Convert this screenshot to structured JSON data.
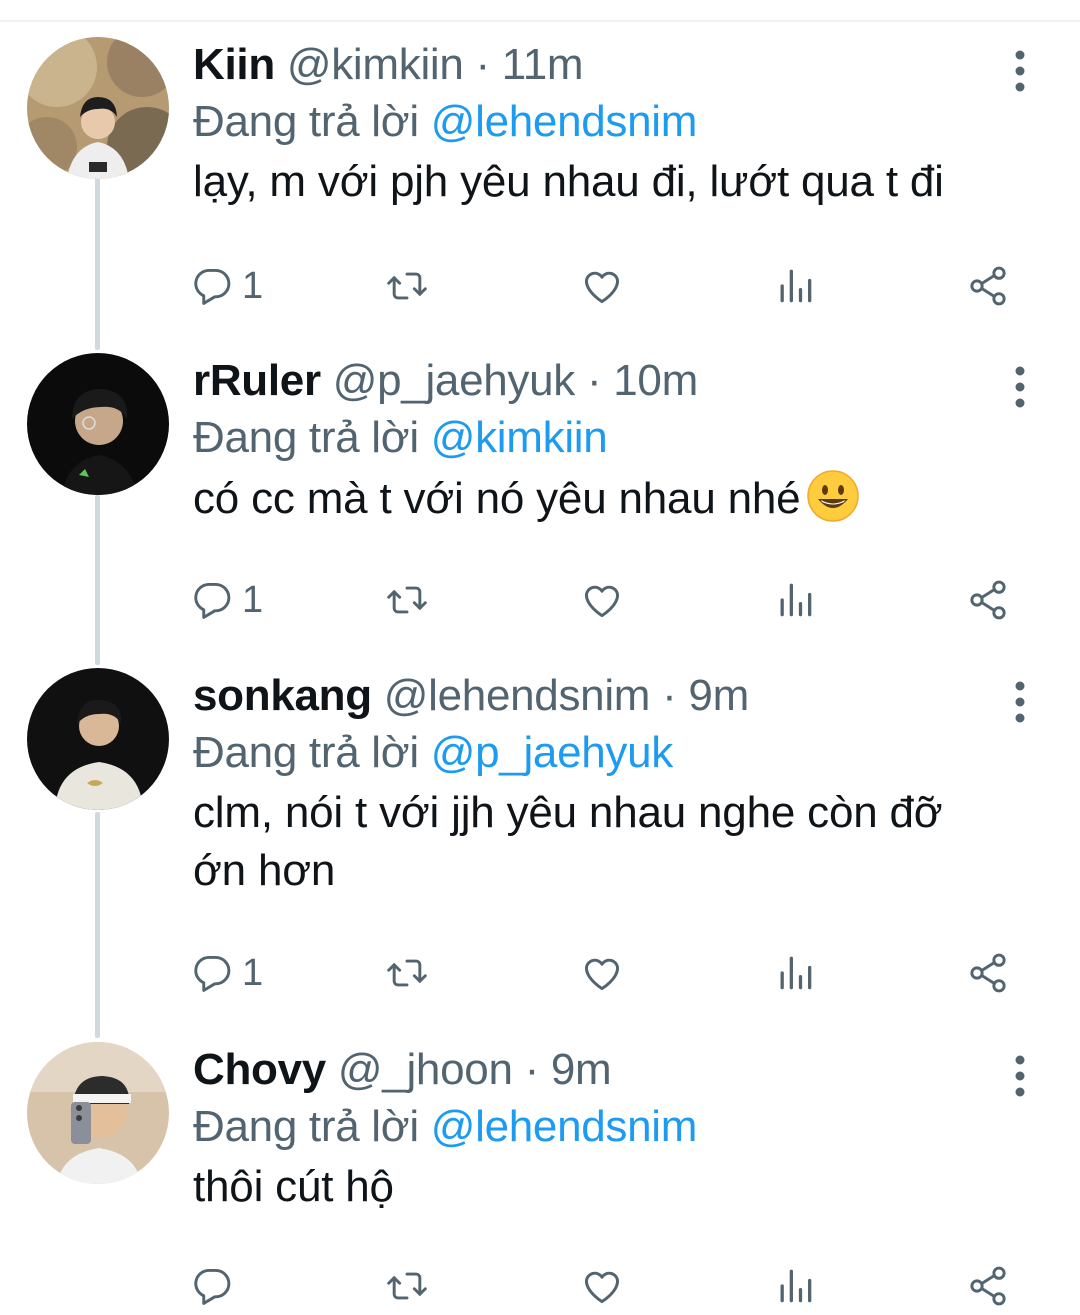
{
  "tweets": [
    {
      "name": "Kiin",
      "handle": "@kimkiin",
      "separator": "·",
      "time": "11m",
      "reply_prefix": "Đang trả lời",
      "reply_to": "@lehendsnim",
      "text": "lạy, m với pjh yêu nhau đi, lướt qua t đi",
      "reply_count": "1",
      "avatar_icon": "profile-photo-outdoor"
    },
    {
      "name": "rRuler",
      "handle": "@p_jaehyuk",
      "separator": "·",
      "time": "10m",
      "reply_prefix": "Đang trả lời",
      "reply_to": "@kimkiin",
      "text": "có cc mà t với nó yêu nhau nhé",
      "emoji": "grinning-face-emoji",
      "reply_count": "1",
      "avatar_icon": "profile-photo-dark"
    },
    {
      "name": "sonkang",
      "handle": "@lehendsnim",
      "separator": "·",
      "time": "9m",
      "reply_prefix": "Đang trả lời",
      "reply_to": "@p_jaehyuk",
      "text_line1": "clm, nói t với jjh yêu nhau nghe còn đỡ",
      "text_line2": "ớn hơn",
      "reply_count": "1",
      "avatar_icon": "profile-photo-white-shirt"
    },
    {
      "name": "Chovy",
      "handle": "@_jhoon",
      "separator": "·",
      "time": "9m",
      "reply_prefix": "Đang trả lời",
      "reply_to": "@lehendsnim",
      "text": "thôi cút hộ",
      "reply_count": "",
      "avatar_icon": "profile-photo-selfie"
    }
  ],
  "icons": {
    "reply": "reply-icon",
    "retweet": "retweet-icon",
    "like": "heart-icon",
    "views": "views-icon",
    "share": "share-icon",
    "more": "more-options-icon"
  },
  "colors": {
    "link": "#1d9bf0",
    "secondary_text": "#536471",
    "primary_text": "#0f1419",
    "thread_line": "#cfd9de"
  }
}
